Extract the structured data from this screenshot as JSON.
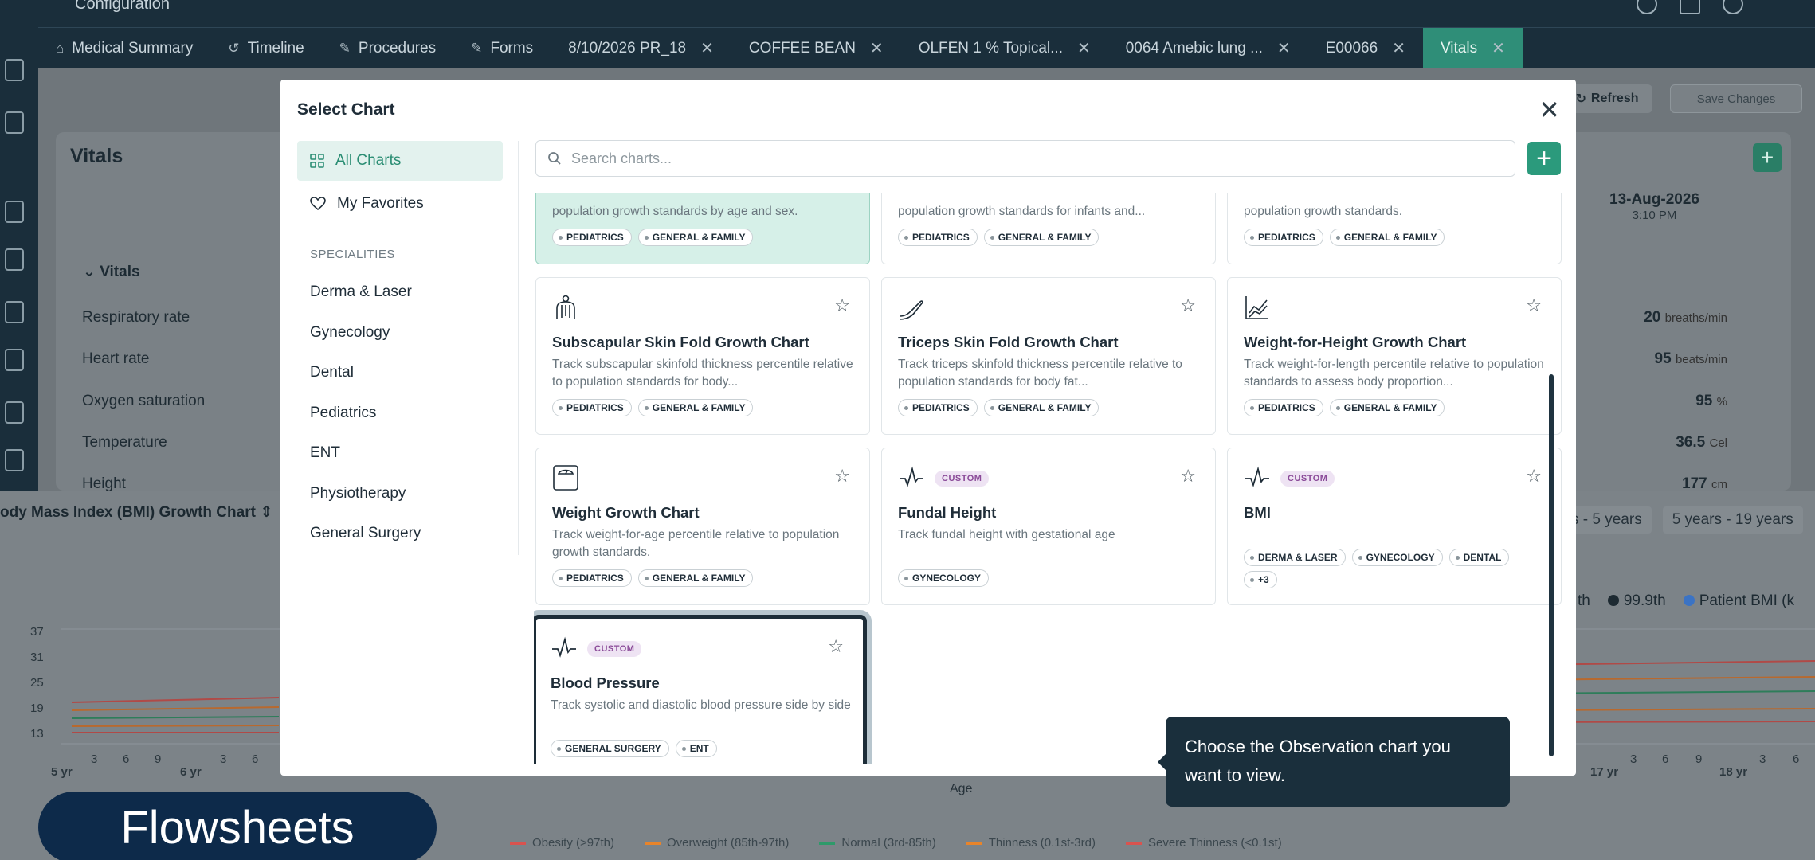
{
  "app": {
    "title": "Configuration"
  },
  "tabs": [
    {
      "label": "Medical Summary",
      "icon": "home-icon",
      "closable": false
    },
    {
      "label": "Timeline",
      "icon": "history-icon",
      "closable": false
    },
    {
      "label": "Procedures",
      "icon": "pen-icon",
      "closable": false
    },
    {
      "label": "Forms",
      "icon": "pen-icon",
      "closable": false
    },
    {
      "label": "8/10/2026 PR_18",
      "closable": true
    },
    {
      "label": "COFFEE BEAN",
      "closable": true
    },
    {
      "label": "OLFEN 1 % Topical...",
      "closable": true
    },
    {
      "label": "0064 Amebic lung ...",
      "closable": true
    },
    {
      "label": "E00066",
      "closable": true
    },
    {
      "label": "Vitals",
      "closable": true,
      "active": true
    }
  ],
  "background": {
    "refresh_label": "Refresh",
    "save_label": "Save Changes",
    "vitals_title": "Vitals",
    "vitals_section": "Vitals",
    "date": "13-Aug-2026",
    "time": "3:10 PM",
    "rows": [
      {
        "label": "Respiratory rate",
        "value": "20",
        "unit": "breaths/min"
      },
      {
        "label": "Heart rate",
        "value": "95",
        "unit": "beats/min"
      },
      {
        "label": "Oxygen saturation",
        "value": "95",
        "unit": "%"
      },
      {
        "label": "Temperature",
        "value": "36.5",
        "unit": "Cel"
      },
      {
        "label": "Height",
        "value": "177",
        "unit": "cm"
      }
    ],
    "chart_selector": "ody Mass Index (BMI) Growth Chart",
    "age_ranges": [
      "s - 5 years",
      "5 years - 19 years"
    ],
    "legend_top": [
      {
        "label": "th",
        "color": "#1d2a32"
      },
      {
        "label": "99.9th",
        "color": "#1d2a32"
      },
      {
        "label": "Patient BMI (k",
        "color": "#3b73c4"
      }
    ],
    "y_ticks": [
      "37",
      "31",
      "25",
      "19",
      "13"
    ],
    "x_ticks_left": [
      "5 yr",
      "3",
      "6",
      "9",
      "6 yr",
      "3",
      "6"
    ],
    "x_ticks_right": [
      "17 yr",
      "3",
      "6",
      "9",
      "18 yr",
      "3",
      "6"
    ],
    "x_axis_label": "Age",
    "legend_bottom": [
      {
        "label": "Obesity (>97th)",
        "color": "#d9534f"
      },
      {
        "label": "Overweight (85th-97th)",
        "color": "#e8842a"
      },
      {
        "label": "Normal (3rd-85th)",
        "color": "#2e9a6a"
      },
      {
        "label": "Thinness (0.1st-3rd)",
        "color": "#e8842a"
      },
      {
        "label": "Severe Thinness (<0.1st)",
        "color": "#d9534f"
      }
    ],
    "flowsheets_label": "Flowsheets"
  },
  "modal": {
    "title": "Select Chart",
    "sidebar": {
      "all_charts": "All Charts",
      "favorites": "My Favorites",
      "specialities_heading": "SPECIALITIES",
      "specialities": [
        "Derma & Laser",
        "Gynecology",
        "Dental",
        "Pediatrics",
        "ENT",
        "Physiotherapy",
        "General Surgery"
      ]
    },
    "search_placeholder": "Search charts...",
    "top_cards": [
      {
        "desc": "population growth standards by age and sex.",
        "tags": [
          "PEDIATRICS",
          "GENERAL & FAMILY"
        ],
        "selected": true
      },
      {
        "desc": "population growth standards for infants and...",
        "tags": [
          "PEDIATRICS",
          "GENERAL & FAMILY"
        ]
      },
      {
        "desc": "population growth standards.",
        "tags": [
          "PEDIATRICS",
          "GENERAL & FAMILY"
        ]
      }
    ],
    "cards": [
      {
        "icon": "body-icon",
        "title": "Subscapular Skin Fold Growth Chart",
        "desc": "Track subscapular skinfold thickness percentile relative to population standards for body...",
        "tags": [
          "PEDIATRICS",
          "GENERAL & FAMILY"
        ]
      },
      {
        "icon": "arm-icon",
        "title": "Triceps Skin Fold Growth Chart",
        "desc": "Track triceps skinfold thickness percentile relative to population standards for body fat...",
        "tags": [
          "PEDIATRICS",
          "GENERAL & FAMILY"
        ]
      },
      {
        "icon": "line-chart-icon",
        "title": "Weight-for-Height Growth Chart",
        "desc": "Track weight-for-length percentile relative to population standards to assess body proportion...",
        "tags": [
          "PEDIATRICS",
          "GENERAL & FAMILY"
        ]
      },
      {
        "icon": "scale-icon",
        "title": "Weight Growth Chart",
        "desc": "Track weight-for-age percentile relative to population growth standards.",
        "tags": [
          "PEDIATRICS",
          "GENERAL & FAMILY"
        ]
      },
      {
        "icon": "pulse-icon",
        "badge": "CUSTOM",
        "title": "Fundal Height",
        "desc": "Track fundal height with gestational age",
        "tags": [
          "GYNECOLOGY"
        ]
      },
      {
        "icon": "pulse-icon",
        "badge": "CUSTOM",
        "title": "BMI",
        "desc": "",
        "tags": [
          "DERMA & LASER",
          "GYNECOLOGY",
          "DENTAL",
          "+3"
        ]
      },
      {
        "icon": "pulse-icon",
        "badge": "CUSTOM",
        "title": "Blood Pressure",
        "desc": "Track systolic and diastolic blood pressure side by side",
        "tags": [
          "GENERAL SURGERY",
          "ENT"
        ]
      }
    ],
    "tooltip": "Choose the Observation chart you want to view."
  }
}
